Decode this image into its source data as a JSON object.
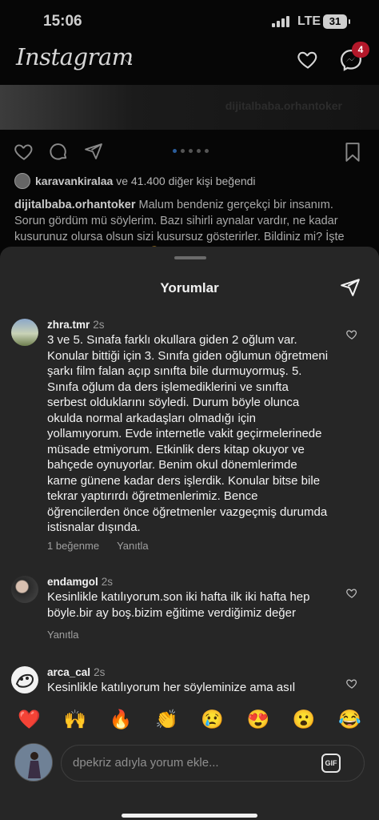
{
  "status": {
    "time": "15:06",
    "network": "LTE",
    "battery": "31"
  },
  "app": {
    "logo": "Instagram",
    "messages_badge": "4"
  },
  "post": {
    "watermark": "dijitalbaba.orhantoker",
    "liked_by_user": "karavankiralaa",
    "liked_by_rest": " ve 41.400 diğer kişi beğendi",
    "caption_user": "dijitalbaba.orhantoker",
    "caption_text": " Malum bendeniz gerçekçi bir insanım. Sorun gördüm mü söylerim. Bazı sihirli aynalar vardır, ne kadar kusurunuz olursa olsun sizi kusursuz gösterirler. Bildiniz mi? İşte ben o aynalardan değilim 😁"
  },
  "sheet": {
    "title": "Yorumlar"
  },
  "comments": [
    {
      "user": "zhra.tmr",
      "time": "2s",
      "text": "3 ve 5. Sınafa farklı okullara giden 2 oğlum var. Konular bittiği için 3. Sınıfa giden oğlumun öğretmeni şarkı film falan açıp sınıfta bile durmuyormuş. 5. Sınıfa oğlum da ders işlemediklerini ve sınıfta serbest olduklarını söyledi. Durum böyle olunca okulda normal arkadaşları olmadığı için yollamıyorum. Evde internetle vakit geçirmelerinede müsade etmiyorum. Etkinlik ders kitap okuyor ve bahçede oynuyorlar. Benim okul dönemlerimde karne günene kadar ders işlerdik. Konular bitse bile tekrar yaptırırdı öğretmenlerimiz. Bence öğrencilerden önce öğretmenler vazgeçmiş durumda istisnalar dışında.",
      "likes": "1 beğenme",
      "reply": "Yanıtla"
    },
    {
      "user": "endamgol",
      "time": "2s",
      "text": "Kesinlikle katılıyorum.son iki hafta ilk iki hafta hep böyle.bir ay boş.bizim eğitime verdiğimiz değer",
      "reply": "Yanıtla"
    },
    {
      "user": "arca_cal",
      "time": "2s",
      "text": "Kesinlikle katılıyorum her söyleminize ama asıl"
    }
  ],
  "reactions": [
    "❤️",
    "🙌",
    "🔥",
    "👏",
    "😢",
    "😍",
    "😮",
    "😂"
  ],
  "composer": {
    "placeholder": "dpekriz adıyla yorum ekle...",
    "gif_label": "GIF"
  }
}
